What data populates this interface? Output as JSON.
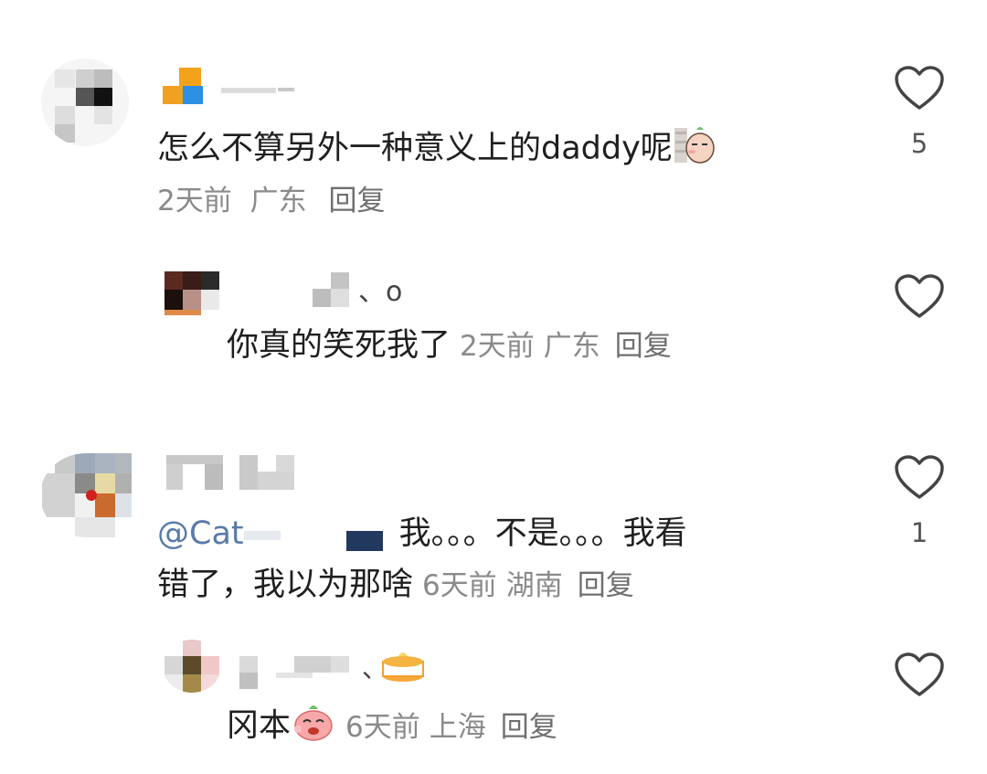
{
  "comments": [
    {
      "text": "怎么不算另外一种意义上的daddy呢",
      "sticker": "shy-sticker-icon",
      "time": "2天前",
      "location": "广东",
      "reply_label": "回复",
      "likes": "5",
      "replies": [
        {
          "text": "你真的笑死我了",
          "time": "2天前",
          "location": "广东",
          "reply_label": "回复",
          "username_visible": "、o"
        }
      ]
    },
    {
      "mention": "@Cat",
      "text_line1": "我。。。不是。。。我看",
      "text_line2": "错了，我以为那啥",
      "time": "6天前",
      "location": "湖南",
      "reply_label": "回复",
      "likes": "1",
      "replies": [
        {
          "text": "冈本",
          "sticker": "peach-laugh-sticker-icon",
          "time": "6天前",
          "location": "上海",
          "reply_label": "回复",
          "username_visible": "、"
        }
      ]
    }
  ],
  "colors": {
    "text": "#1f1f1f",
    "meta": "#8a8a8a",
    "heart_stroke": "#444444"
  }
}
